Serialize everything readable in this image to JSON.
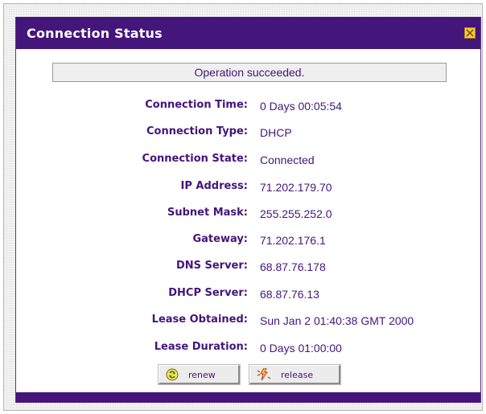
{
  "window": {
    "title": "Connection Status",
    "close_icon": "close-icon"
  },
  "message": "Operation succeeded.",
  "fields": [
    {
      "label": "Connection Time:",
      "value": "0 Days 00:05:54"
    },
    {
      "label": "Connection Type:",
      "value": "DHCP"
    },
    {
      "label": "Connection State:",
      "value": "Connected"
    },
    {
      "label": "IP Address:",
      "value": "71.202.179.70"
    },
    {
      "label": "Subnet Mask:",
      "value": "255.255.252.0"
    },
    {
      "label": "Gateway:",
      "value": "71.202.176.1"
    },
    {
      "label": "DNS Server:",
      "value": "68.87.76.178"
    },
    {
      "label": "DHCP Server:",
      "value": "68.87.76.13"
    },
    {
      "label": "Lease Obtained:",
      "value": "Sun Jan 2 01:40:38 GMT 2000"
    },
    {
      "label": "Lease Duration:",
      "value": "0 Days 01:00:00"
    }
  ],
  "buttons": {
    "renew": {
      "label": "renew",
      "icon": "renew-icon"
    },
    "release": {
      "label": "release",
      "icon": "release-icon"
    }
  },
  "colors": {
    "accent": "#44157a",
    "background": "#ffffff",
    "message_bg": "#efefef"
  }
}
